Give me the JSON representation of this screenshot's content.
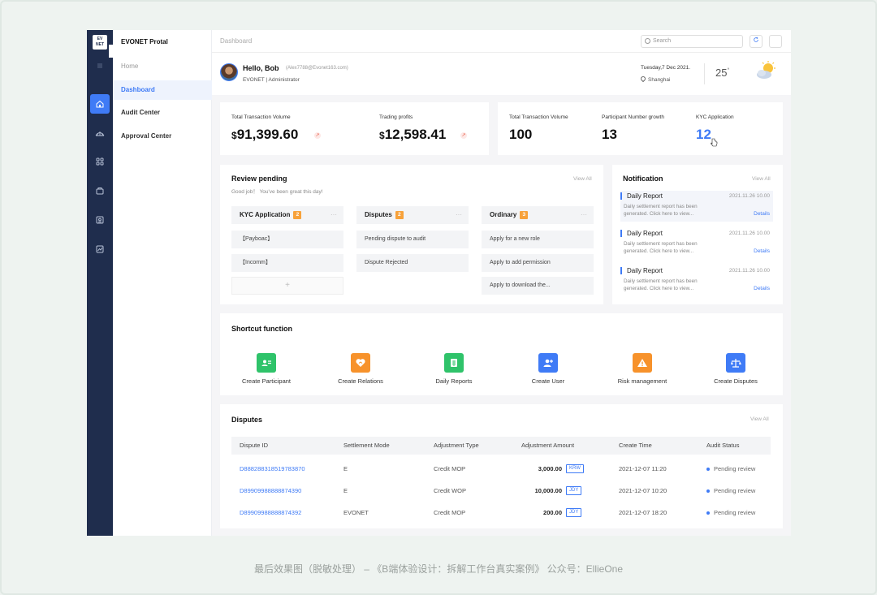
{
  "app": {
    "logo_line1": "EV",
    "logo_line2": "NET",
    "portal_title": "EVONET Protal"
  },
  "menu": {
    "items": [
      "Home",
      "Dashboard",
      "Audit Center",
      "Approval Center"
    ],
    "active": "Dashboard"
  },
  "rail_icons": [
    "menu-icon",
    "home-icon",
    "bridge-icon",
    "apps-icon",
    "box-icon",
    "badge-icon",
    "chart-icon"
  ],
  "topbar": {
    "breadcrumb": "Dashboard",
    "search_placeholder": "Search"
  },
  "greeting": {
    "hello": "Hello, Bob",
    "email": "(Alex7788@Evonet163.com)",
    "org": "EVONET  | Administrator",
    "date": "Tuesday,7 Dec 2021.",
    "city": "Shanghai",
    "temperature": "25",
    "temp_unit": "°"
  },
  "stats_left": [
    {
      "label": "Total Transaction Volume",
      "currency": "$",
      "value": "91,399.60"
    },
    {
      "label": "Trading profits",
      "currency": "$",
      "value": "12,598.41"
    }
  ],
  "stats_right": [
    {
      "label": "Total Transaction Volume",
      "value": "100"
    },
    {
      "label": "Participant Number growth",
      "value": "13"
    },
    {
      "label": "KYC Application",
      "value": "12"
    }
  ],
  "review": {
    "title": "Review pending",
    "subtitle": "Good job！ You've been great this day!",
    "view_all": "View All",
    "columns": [
      {
        "title": "KYC Application",
        "count": "2",
        "items": [
          "【Payboac】",
          "【Incomm】"
        ],
        "add": "+"
      },
      {
        "title": "Disputes",
        "count": "2",
        "items": [
          "Pending dispute to audit",
          "Dispute Rejected"
        ]
      },
      {
        "title": "Ordinary",
        "count": "3",
        "items": [
          "Apply for a new role",
          "Apply to add permission",
          "Apply to download the..."
        ]
      }
    ]
  },
  "notification": {
    "title": "Notification",
    "view_all": "View All",
    "items": [
      {
        "title": "Daily Report",
        "date": "2021.11.26 10.00",
        "text": "Daily settlement report has been generated. Click here to view...",
        "link": "Details"
      },
      {
        "title": "Daily Report",
        "date": "2021.11.26 10.00",
        "text": "Daily settlement report has been generated. Click here to view...",
        "link": "Details"
      },
      {
        "title": "Daily Report",
        "date": "2021.11.26 10.00",
        "text": "Daily settlement report has been generated. Click here to view...",
        "link": "Details"
      }
    ]
  },
  "shortcuts": {
    "title": "Shortcut function",
    "items": [
      {
        "label": "Create Participant",
        "color": "#2fc36a",
        "icon": "id-card-icon"
      },
      {
        "label": "Create Relations",
        "color": "#f7922b",
        "icon": "heart-shield-icon"
      },
      {
        "label": "Daily Reports",
        "color": "#2fc36a",
        "icon": "sheet-icon"
      },
      {
        "label": "Create User",
        "color": "#3f7bf6",
        "icon": "user-add-icon"
      },
      {
        "label": "Risk management",
        "color": "#f7922b",
        "icon": "warning-icon"
      },
      {
        "label": "Create Disputes",
        "color": "#3f7bf6",
        "icon": "scale-icon"
      }
    ]
  },
  "disputes": {
    "title": "Disputes",
    "view_all": "View All",
    "headers": [
      "Dispute ID",
      "Settlement Mode",
      "Adjustment Type",
      "Adjustment Amount",
      "Create Time",
      "Audit Status"
    ],
    "rows": [
      {
        "id": "D88828831851978387​0",
        "mode": "E",
        "type": "Credit MOP",
        "amount": "3,000.00",
        "currency": "KRW",
        "time": "2021-12-07 11:20",
        "status": "Pending review"
      },
      {
        "id": "D89909988888874390",
        "mode": "E",
        "type": "Credit WOP",
        "amount": "10,000.00",
        "currency": "JDY",
        "time": "2021-12-07 10:20",
        "status": "Pending review"
      },
      {
        "id": "D89909988888874392",
        "mode": "EVONET",
        "type": "Credit MOP",
        "amount": "200.00",
        "currency": "JDY",
        "time": "2021-12-07 18:20",
        "status": "Pending review"
      }
    ]
  },
  "caption": "最后效果图（脱敏处理） – 《B端体验设计：拆解工作台真实案例》 公众号：EllieOne",
  "colors": {
    "rail": "#1f2d4d",
    "accent": "#3f7bf6",
    "badge": "#f7a23b"
  }
}
